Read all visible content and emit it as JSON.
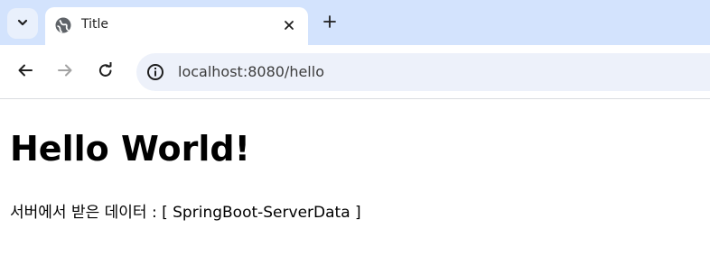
{
  "browser": {
    "tab": {
      "title": "Title",
      "favicon": "globe-icon"
    },
    "address_bar": {
      "url": "localhost:8080/hello"
    },
    "icons": {
      "tab_search": "chevron-down-icon",
      "close": "close-icon",
      "new_tab": "plus-icon",
      "back": "back-arrow-icon",
      "forward": "forward-arrow-icon",
      "reload": "reload-icon",
      "site_info": "info-icon"
    },
    "colors": {
      "tabstrip": "#d3e3fd",
      "omnibox": "#edf1fa"
    }
  },
  "page": {
    "heading": "Hello World!",
    "message_label": "서버에서 받은 데이터 : ",
    "message_value": "[ SpringBoot-ServerData ]"
  }
}
